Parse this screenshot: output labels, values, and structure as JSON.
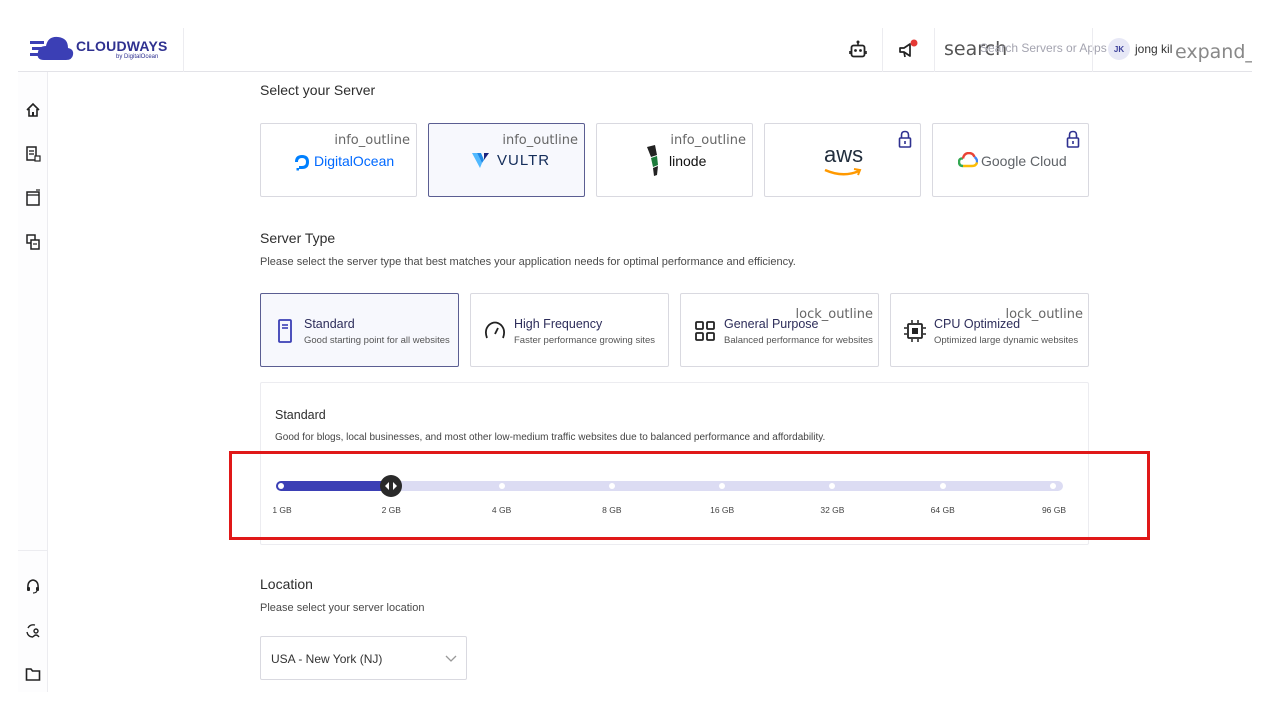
{
  "header": {
    "brand": "CLOUDWAYS",
    "brand_sub": "by DigitalOcean",
    "search_icon_text": "search",
    "search_placeholder": "Search Servers or Apps",
    "avatar_initials": "JK",
    "username": "jong kil",
    "expand_icon_text": "expand_r"
  },
  "server_select": {
    "title": "Select your Server",
    "providers": [
      {
        "name": "DigitalOcean",
        "badge": "info_outline",
        "selected": false
      },
      {
        "name": "VULTR",
        "badge": "info_outline",
        "selected": true
      },
      {
        "name": "linode",
        "badge": "info_outline",
        "selected": false
      },
      {
        "name": "aws",
        "badge": "lock",
        "selected": false
      },
      {
        "name": "Google Cloud",
        "badge": "lock",
        "selected": false
      }
    ]
  },
  "server_type": {
    "title": "Server Type",
    "description": "Please select the server type that best matches your application needs for optimal performance and efficiency.",
    "types": [
      {
        "title": "Standard",
        "desc": "Good starting point for all websites",
        "badge": "",
        "selected": true
      },
      {
        "title": "High Frequency",
        "desc": "Faster performance growing sites",
        "badge": "",
        "selected": false
      },
      {
        "title": "General Purpose",
        "desc": "Balanced performance for websites",
        "badge": "lock_outline",
        "selected": false
      },
      {
        "title": "CPU Optimized",
        "desc": "Optimized large dynamic websites",
        "badge": "lock_outline",
        "selected": false
      }
    ]
  },
  "size": {
    "title": "Standard",
    "description": "Good for blogs, local businesses, and most other low-medium traffic websites due to balanced performance and affordability.",
    "ticks": [
      "1 GB",
      "2 GB",
      "4 GB",
      "8 GB",
      "16 GB",
      "32 GB",
      "64 GB",
      "96 GB"
    ],
    "selected_index": 1
  },
  "location": {
    "title": "Location",
    "description": "Please select your server location",
    "selected": "USA - New York (NJ)"
  },
  "colors": {
    "accent": "#3b3fb5",
    "track": "#dcdcf3",
    "highlight": "#e01818"
  }
}
